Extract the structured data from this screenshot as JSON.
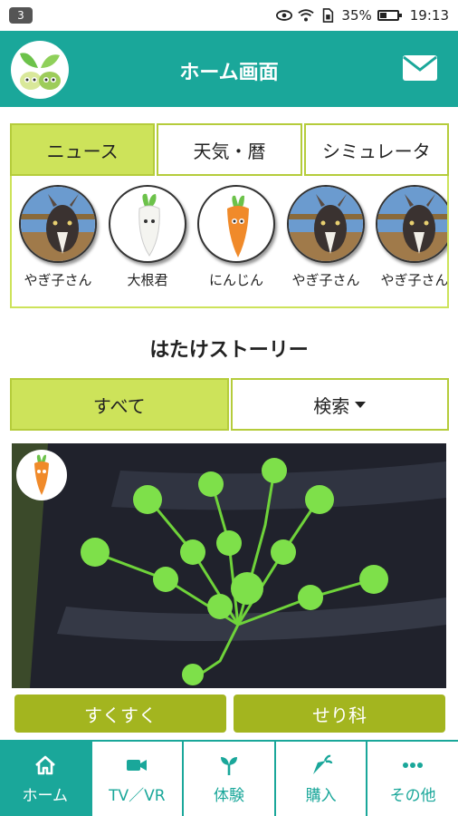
{
  "status_bar": {
    "badge": "3",
    "battery": "35%",
    "time": "19:13"
  },
  "header": {
    "title": "ホーム画面"
  },
  "tabs": [
    {
      "label": "ニュース",
      "active": true
    },
    {
      "label": "天気・暦",
      "active": false
    },
    {
      "label": "シミュレータ",
      "active": false
    }
  ],
  "characters": [
    {
      "name": "やぎ子さん",
      "icon": "goat"
    },
    {
      "name": "大根君",
      "icon": "daikon"
    },
    {
      "name": "にんじん",
      "icon": "carrot"
    },
    {
      "name": "やぎ子さん",
      "icon": "goat"
    },
    {
      "name": "やぎ子さん",
      "icon": "goat"
    }
  ],
  "section_title": "はたけストーリー",
  "filter": {
    "all_label": "すべて",
    "search_label": "検索"
  },
  "story": {
    "tags": [
      "すくすく",
      "せり科"
    ]
  },
  "bottom_nav": [
    {
      "label": "ホーム",
      "icon": "home-icon",
      "active": true
    },
    {
      "label": "TV／VR",
      "icon": "video-icon",
      "active": false
    },
    {
      "label": "体験",
      "icon": "sprout-icon",
      "active": false
    },
    {
      "label": "購入",
      "icon": "carrot-icon",
      "active": false
    },
    {
      "label": "その他",
      "icon": "more-icon",
      "active": false
    }
  ],
  "colors": {
    "teal": "#1aa79a",
    "lime": "#cde35a",
    "olive": "#a3b51f"
  }
}
